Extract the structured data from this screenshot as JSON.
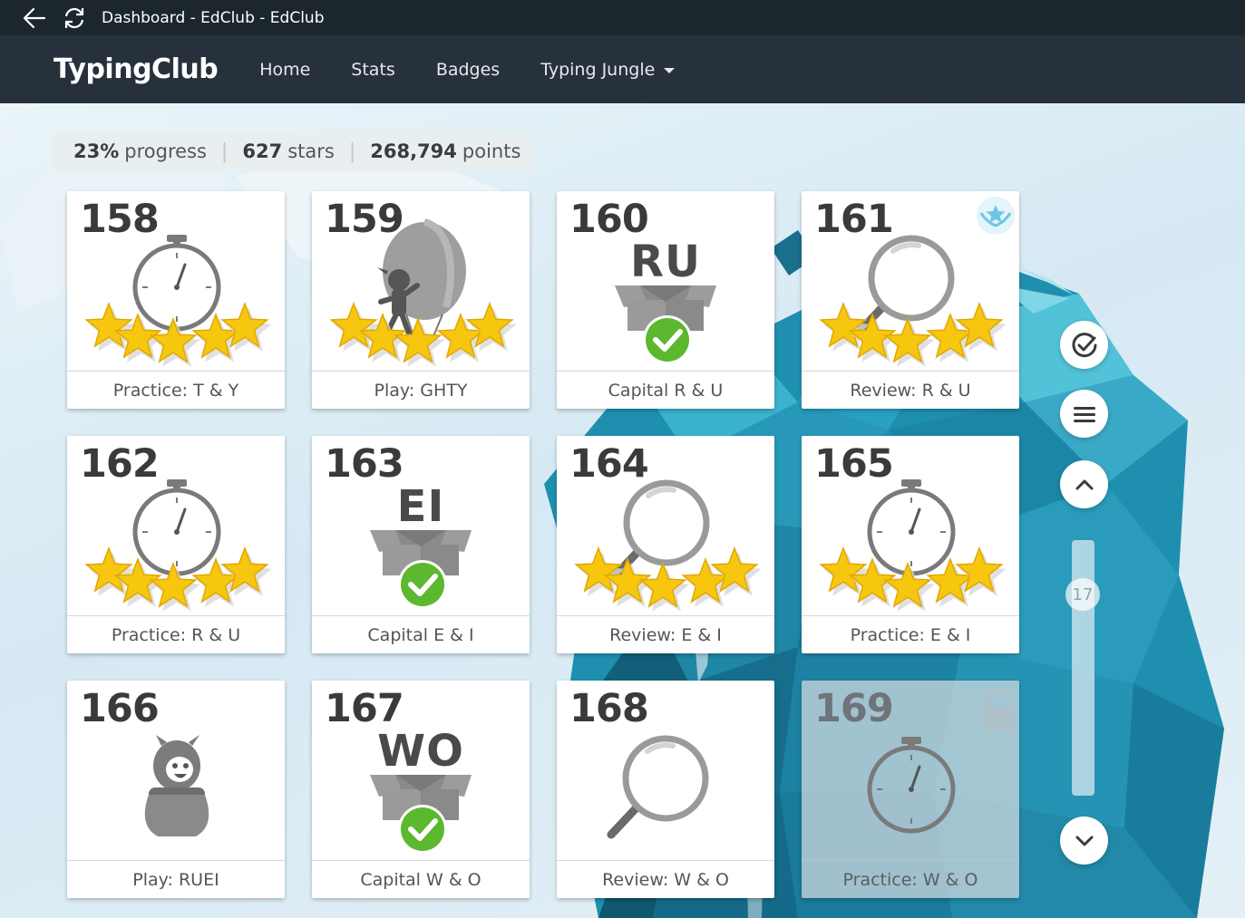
{
  "window": {
    "title": "Dashboard - EdClub - EdClub"
  },
  "nav": {
    "brand": "TypingClub",
    "items": [
      {
        "label": "Home"
      },
      {
        "label": "Stats"
      },
      {
        "label": "Badges"
      },
      {
        "label": "Typing Jungle",
        "dropdown": true
      }
    ]
  },
  "summary": {
    "progress_value": "23%",
    "progress_label": "progress",
    "stars_value": "627",
    "stars_label": "stars",
    "points_value": "268,794",
    "points_label": "points"
  },
  "lessons": [
    {
      "number": "158",
      "label": "Practice: T & Y",
      "icon": "stopwatch-icon",
      "stars": 5
    },
    {
      "number": "159",
      "label": "Play: GHTY",
      "icon": "balloon-game-icon",
      "stars": 5
    },
    {
      "number": "160",
      "label": "Capital R & U",
      "icon": "box-letters-icon",
      "letters": "RU",
      "completed": true
    },
    {
      "number": "161",
      "label": "Review: R & U",
      "icon": "magnifier-icon",
      "stars": 5,
      "badge": "star-badge-icon"
    },
    {
      "number": "162",
      "label": "Practice: R & U",
      "icon": "stopwatch-icon",
      "stars": 5
    },
    {
      "number": "163",
      "label": "Capital E & I",
      "icon": "box-letters-icon",
      "letters": "EI",
      "completed": true
    },
    {
      "number": "164",
      "label": "Review: E & I",
      "icon": "magnifier-icon",
      "stars": 5
    },
    {
      "number": "165",
      "label": "Practice: E & I",
      "icon": "stopwatch-icon",
      "stars": 5
    },
    {
      "number": "166",
      "label": "Play: RUEI",
      "icon": "character-pot-icon",
      "stars": 0
    },
    {
      "number": "167",
      "label": "Capital W & O",
      "icon": "box-letters-icon",
      "letters": "WO",
      "completed": true
    },
    {
      "number": "168",
      "label": "Review: W & O",
      "icon": "magnifier-icon",
      "stars": 0
    },
    {
      "number": "169",
      "label": "Practice: W & O",
      "icon": "stopwatch-icon",
      "stars": 0,
      "locked": true
    }
  ],
  "rail": {
    "buttons": [
      "check-badge-icon",
      "menu-icon",
      "chevron-up-icon",
      "chevron-down-icon"
    ],
    "scroll_value": "17"
  },
  "colors": {
    "titlebar": "#1c262d",
    "navbar": "#27313b",
    "star": "#f7c70f",
    "check": "#5cb82e",
    "icon_gray": "#7a7a7a"
  }
}
